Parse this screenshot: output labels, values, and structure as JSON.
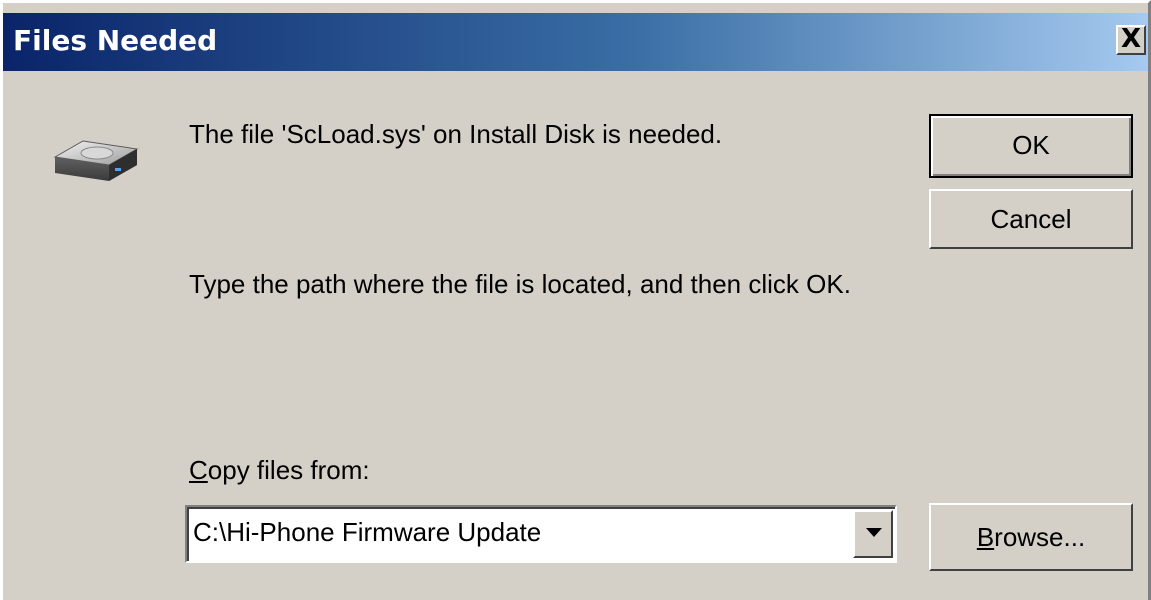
{
  "window": {
    "title": "Files Needed",
    "close_glyph": "×",
    "close_label": "X"
  },
  "message": {
    "needed": "The file 'ScLoad.sys' on Install Disk is needed.",
    "instruction": "Type the path where the file is located, and then click OK."
  },
  "copy_from": {
    "label_mnemonic": "C",
    "label_rest": "opy files from:",
    "value": "C:\\Hi-Phone Firmware Update"
  },
  "buttons": {
    "ok": "OK",
    "cancel": "Cancel",
    "browse_mnemonic": "B",
    "browse_rest": "rowse..."
  },
  "icons": {
    "disk": "disk-drive-icon",
    "dropdown": "chevron-down-icon"
  },
  "colors": {
    "titlebar_start": "#0a246a",
    "titlebar_end": "#a6caf0",
    "dialog_face": "#d4d0c8"
  }
}
